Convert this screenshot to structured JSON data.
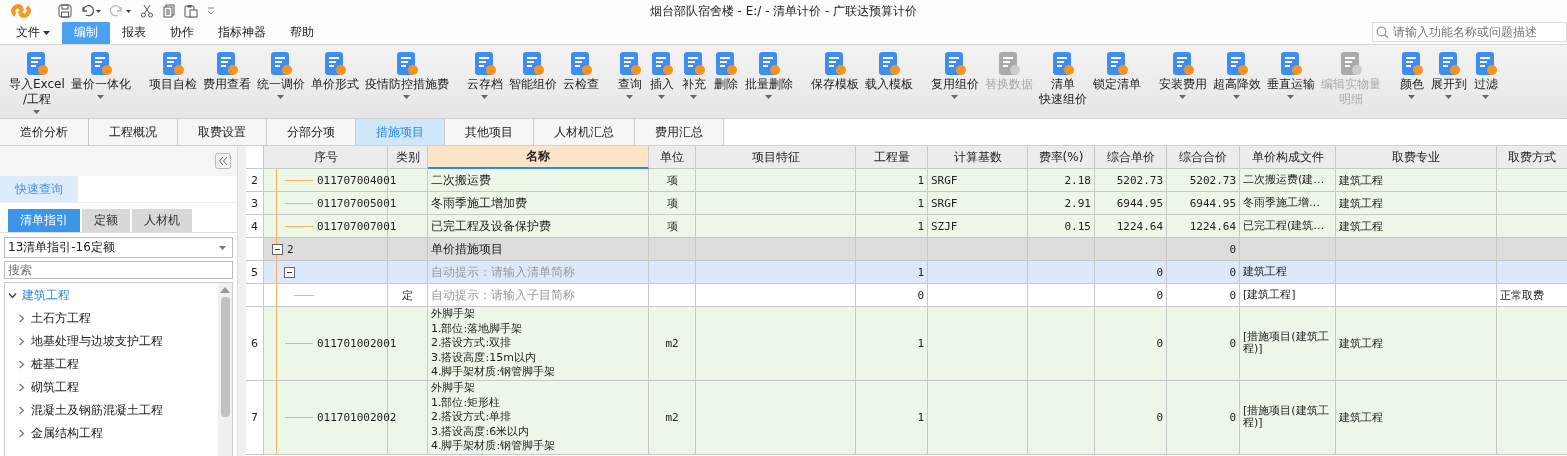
{
  "window": {
    "title": "烟台部队宿舍楼 - E:/ - 清单计价 - 广联达预算计价"
  },
  "menu": [
    {
      "label": "文件",
      "dropdown": true,
      "selected": false
    },
    {
      "label": "编制",
      "dropdown": false,
      "selected": true
    },
    {
      "label": "报表",
      "dropdown": false,
      "selected": false
    },
    {
      "label": "协作",
      "dropdown": false,
      "selected": false
    },
    {
      "label": "指标神器",
      "dropdown": false,
      "selected": false
    },
    {
      "label": "帮助",
      "dropdown": false,
      "selected": false
    }
  ],
  "search": {
    "placeholder": "请输入功能名称或问题描述"
  },
  "toolbar": [
    {
      "lines": [
        "导入Excel",
        "/工程"
      ],
      "dropdown": true,
      "disabled": false
    },
    {
      "lines": [
        "量价一体化"
      ],
      "dropdown": true,
      "disabled": false
    },
    {
      "lines": [
        "项目自检"
      ],
      "dropdown": false,
      "disabled": false
    },
    {
      "lines": [
        "费用查看"
      ],
      "dropdown": false,
      "disabled": false
    },
    {
      "lines": [
        "统一调价"
      ],
      "dropdown": true,
      "disabled": false
    },
    {
      "lines": [
        "单价形式"
      ],
      "dropdown": false,
      "disabled": false
    },
    {
      "lines": [
        "疫情防控措施费"
      ],
      "dropdown": true,
      "disabled": false
    },
    {
      "lines": [
        "云存档"
      ],
      "dropdown": true,
      "disabled": false
    },
    {
      "lines": [
        "智能组价"
      ],
      "dropdown": false,
      "disabled": false
    },
    {
      "lines": [
        "云检查"
      ],
      "dropdown": false,
      "disabled": false
    },
    {
      "lines": [
        "查询"
      ],
      "dropdown": true,
      "disabled": false
    },
    {
      "lines": [
        "插入"
      ],
      "dropdown": true,
      "disabled": false
    },
    {
      "lines": [
        "补充"
      ],
      "dropdown": true,
      "disabled": false
    },
    {
      "lines": [
        "删除"
      ],
      "dropdown": false,
      "disabled": false
    },
    {
      "lines": [
        "批量删除"
      ],
      "dropdown": true,
      "disabled": false
    },
    {
      "lines": [
        "保存模板"
      ],
      "dropdown": false,
      "disabled": false
    },
    {
      "lines": [
        "载入模板"
      ],
      "dropdown": false,
      "disabled": false
    },
    {
      "lines": [
        "复用组价"
      ],
      "dropdown": true,
      "disabled": false
    },
    {
      "lines": [
        "替换数据"
      ],
      "dropdown": false,
      "disabled": true
    },
    {
      "lines": [
        "清单",
        "快速组价"
      ],
      "dropdown": false,
      "disabled": false
    },
    {
      "lines": [
        "锁定清单"
      ],
      "dropdown": false,
      "disabled": false
    },
    {
      "lines": [
        "安装费用"
      ],
      "dropdown": true,
      "disabled": false
    },
    {
      "lines": [
        "超高降效"
      ],
      "dropdown": true,
      "disabled": false
    },
    {
      "lines": [
        "垂直运输"
      ],
      "dropdown": true,
      "disabled": false
    },
    {
      "lines": [
        "编辑实物量",
        "明细"
      ],
      "dropdown": false,
      "disabled": true
    },
    {
      "lines": [
        "颜色"
      ],
      "dropdown": true,
      "disabled": false
    },
    {
      "lines": [
        "展开到"
      ],
      "dropdown": true,
      "disabled": false
    },
    {
      "lines": [
        "过滤"
      ],
      "dropdown": true,
      "disabled": false
    }
  ],
  "tabs": [
    {
      "label": "造价分析",
      "selected": false
    },
    {
      "label": "工程概况",
      "selected": false
    },
    {
      "label": "取费设置",
      "selected": false
    },
    {
      "label": "分部分项",
      "selected": false
    },
    {
      "label": "措施项目",
      "selected": true
    },
    {
      "label": "其他项目",
      "selected": false
    },
    {
      "label": "人材机汇总",
      "selected": false
    },
    {
      "label": "费用汇总",
      "selected": false
    }
  ],
  "sidebar": {
    "quick_query": {
      "label": "快速查询",
      "selected": true
    },
    "tabs": [
      {
        "label": "清单指引",
        "selected": true
      },
      {
        "label": "定额",
        "selected": false
      },
      {
        "label": "人材机",
        "selected": false
      }
    ],
    "library": "13清单指引-16定额",
    "search": {
      "placeholder": "搜索"
    },
    "tree": [
      {
        "label": "建筑工程",
        "expanded": true,
        "selected": true,
        "children": [
          {
            "label": "土石方工程",
            "expanded": false
          },
          {
            "label": "地基处理与边坡支护工程",
            "expanded": false
          },
          {
            "label": "桩基工程",
            "expanded": false
          },
          {
            "label": "砌筑工程",
            "expanded": false
          },
          {
            "label": "混凝土及钢筋混凝土工程",
            "expanded": false
          },
          {
            "label": "金属结构工程",
            "expanded": false
          }
        ]
      }
    ]
  },
  "table": {
    "columns": [
      {
        "label": "序号",
        "selected": false
      },
      {
        "label": "类别",
        "selected": false
      },
      {
        "label": "名称",
        "selected": true
      },
      {
        "label": "单位",
        "selected": false
      },
      {
        "label": "项目特征",
        "selected": false
      },
      {
        "label": "工程量",
        "selected": false
      },
      {
        "label": "计算基数",
        "selected": false
      },
      {
        "label": "费率(%)",
        "selected": false
      },
      {
        "label": "综合单价",
        "selected": false
      },
      {
        "label": "综合合价",
        "selected": false
      },
      {
        "label": "单价构成文件",
        "selected": false
      },
      {
        "label": "取费专业",
        "selected": false
      },
      {
        "label": "取费方式",
        "selected": false
      }
    ],
    "rows": [
      {
        "kind": "item",
        "num": "2",
        "code": "011707004001",
        "name": [
          "二次搬运费"
        ],
        "unit": "项",
        "qty": "1",
        "base": "SRGF",
        "rate": "2.18",
        "unit_price": "5202.73",
        "total": "5202.73",
        "file": "二次搬运费(建…",
        "specialty": "建筑工程"
      },
      {
        "kind": "item",
        "num": "3",
        "code": "011707005001",
        "name": [
          "冬雨季施工增加费"
        ],
        "unit": "项",
        "qty": "1",
        "base": "SRGF",
        "rate": "2.91",
        "unit_price": "6944.95",
        "total": "6944.95",
        "file": "冬雨季施工增…",
        "specialty": "建筑工程"
      },
      {
        "kind": "item",
        "num": "4",
        "code": "011707007001",
        "name": [
          "已完工程及设备保护费"
        ],
        "unit": "项",
        "qty": "1",
        "base": "SZJF",
        "rate": "0.15",
        "unit_price": "1224.64",
        "total": "1224.64",
        "file": "已完工程(建筑…",
        "specialty": "建筑工程"
      },
      {
        "kind": "group",
        "code": "2",
        "expanded": true,
        "name": [
          "单价措施项目"
        ],
        "total": "0"
      },
      {
        "kind": "new",
        "num": "5",
        "expanded": true,
        "name": [
          "自动提示：请输入清单简称"
        ],
        "qty": "1",
        "unit_price": "0",
        "total": "0",
        "file": "建筑工程"
      },
      {
        "kind": "sub",
        "type": "定",
        "name": [
          "自动提示：请输入子目简称"
        ],
        "qty": "0",
        "unit_price": "0",
        "total": "0",
        "file": "[建筑工程]",
        "method": "正常取费"
      },
      {
        "kind": "item",
        "num": "6",
        "code": "011701002001",
        "name": [
          "外脚手架",
          "1.部位:落地脚手架",
          "2.搭设方式:双排",
          "3.搭设高度:15m以内",
          "4.脚手架材质:钢管脚手架"
        ],
        "unit": "m2",
        "qty": "1",
        "unit_price": "0",
        "total": "0",
        "file": "[措施项目(建筑工程)]",
        "specialty": "建筑工程"
      },
      {
        "kind": "item",
        "num": "7",
        "code": "011701002002",
        "name": [
          "外脚手架",
          "1.部位:矩形柱",
          "2.搭设方式:单排",
          "3.搭设高度:6米以内",
          "4.脚手架材质:钢管脚手架"
        ],
        "unit": "m2",
        "qty": "1",
        "unit_price": "0",
        "total": "0",
        "file": "[措施项目(建筑工程)]",
        "specialty": "建筑工程"
      }
    ]
  }
}
